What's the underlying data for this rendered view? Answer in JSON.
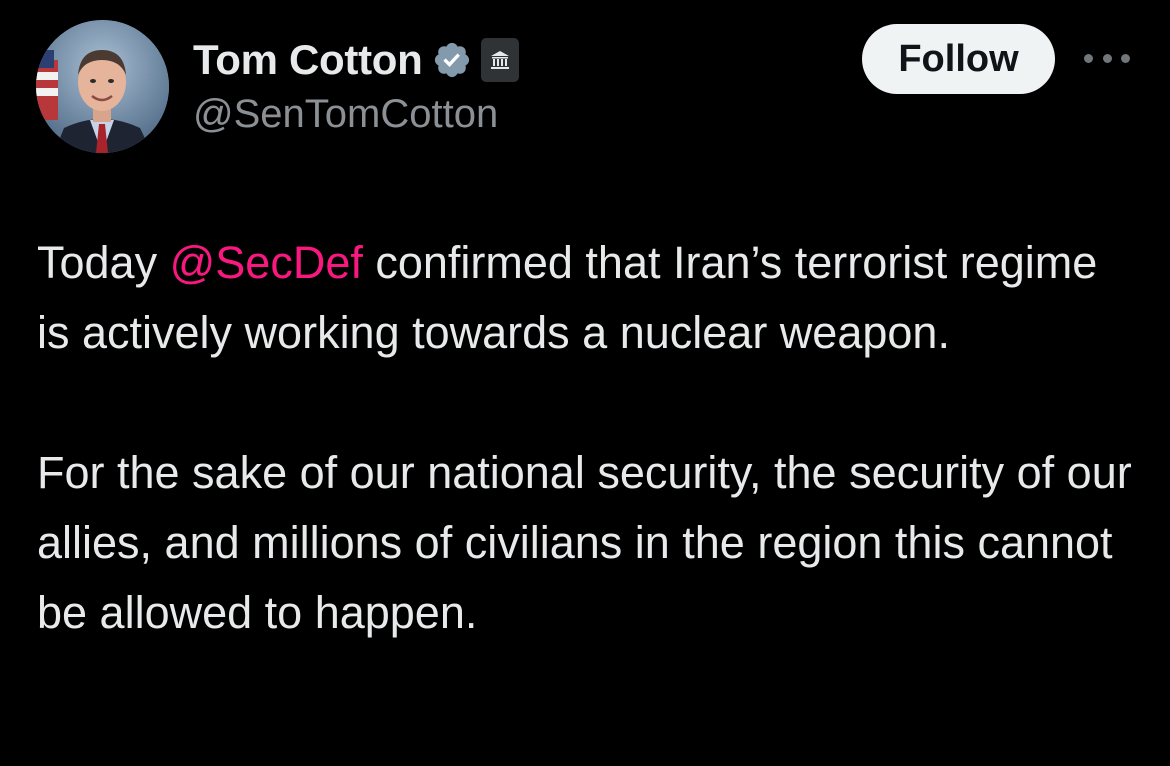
{
  "author": {
    "display_name": "Tom Cotton",
    "handle": "@SenTomCotton",
    "verified_icon": "verified-badge-icon",
    "affiliation_icon": "government-building-icon"
  },
  "actions": {
    "follow_label": "Follow",
    "more_icon": "more-horizontal-icon"
  },
  "tweet": {
    "para1_before": "Today ",
    "mention": "@SecDef",
    "para1_after": " confirmed that Iran’s terrorist regime is actively working towards a nuclear weapon.",
    "para2": "For the sake of our national security, the security of our allies, and millions of civilians in the region this cannot be allowed to happen."
  },
  "colors": {
    "background": "#000000",
    "text": "#e7e9ea",
    "secondary_text": "#8b9095",
    "mention": "#f91880",
    "follow_button_bg": "#eff3f4",
    "verified_badge": "#829aab"
  }
}
